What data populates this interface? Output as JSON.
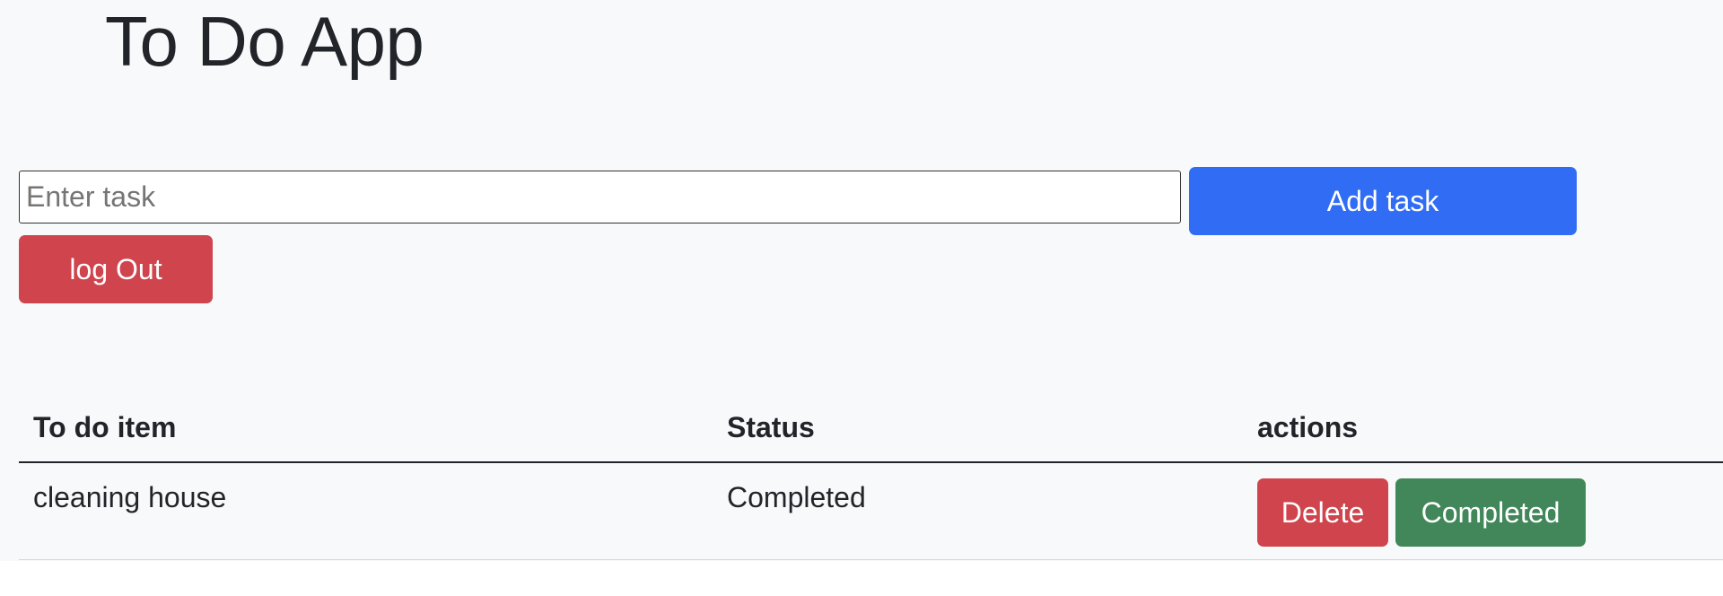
{
  "app": {
    "title": "To Do App"
  },
  "form": {
    "task_placeholder": "Enter task",
    "task_value": "",
    "add_label": "Add task",
    "logout_label": "log Out"
  },
  "colors": {
    "add_button": "#316cf4",
    "danger_button": "#cf444d",
    "success_button": "#41875a",
    "page_background": "#f8f9fa"
  },
  "table": {
    "headers": [
      "To do item",
      "Status",
      "actions"
    ],
    "rows": [
      {
        "item": "cleaning house",
        "status": "Completed",
        "actions": {
          "delete_label": "Delete",
          "complete_label": "Completed"
        }
      }
    ]
  }
}
